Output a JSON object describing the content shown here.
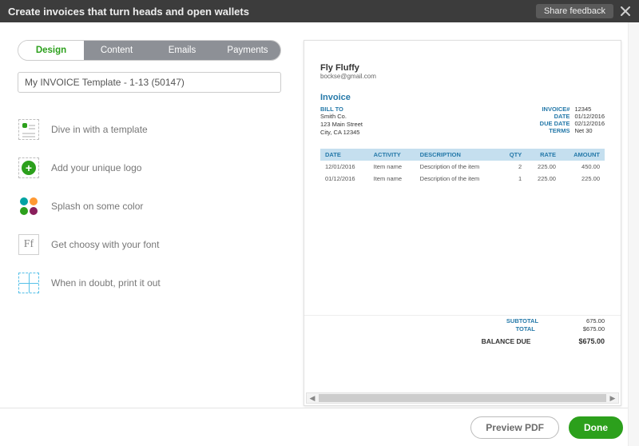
{
  "header": {
    "title": "Create invoices that turn heads and open wallets",
    "feedback_label": "Share feedback"
  },
  "tabs": [
    {
      "label": "Design",
      "active": true
    },
    {
      "label": "Content",
      "active": false
    },
    {
      "label": "Emails",
      "active": false
    },
    {
      "label": "Payments",
      "active": false
    }
  ],
  "template_name_value": "My INVOICE Template - 1-13 (50147)",
  "options": {
    "template_label": "Dive in with a template",
    "logo_label": "Add your unique logo",
    "color_label": "Splash on some color",
    "font_label": "Get choosy with your font",
    "print_label": "When in doubt, print it out",
    "font_sample": "Ff"
  },
  "invoice": {
    "company_name": "Fly Fluffy",
    "company_email": "bockse@gmail.com",
    "doc_title": "Invoice",
    "bill_to_label": "BILL TO",
    "bill_to_name": "Smith Co.",
    "bill_to_street": "123 Main Street",
    "bill_to_city": "City, CA 12345",
    "meta": {
      "invoice_label": "INVOICE#",
      "invoice_value": "12345",
      "date_label": "DATE",
      "date_value": "01/12/2016",
      "due_label": "DUE DATE",
      "due_value": "02/12/2016",
      "terms_label": "TERMS",
      "terms_value": "Net 30"
    },
    "columns": {
      "date": "DATE",
      "activity": "ACTIVITY",
      "description": "DESCRIPTION",
      "qty": "QTY",
      "rate": "RATE",
      "amount": "AMOUNT"
    },
    "lines": [
      {
        "date": "12/01/2016",
        "activity": "Item name",
        "description": "Description of the item",
        "qty": "2",
        "rate": "225.00",
        "amount": "450.00"
      },
      {
        "date": "01/12/2016",
        "activity": "Item name",
        "description": "Description of the item",
        "qty": "1",
        "rate": "225.00",
        "amount": "225.00"
      }
    ],
    "totals": {
      "subtotal_label": "SUBTOTAL",
      "subtotal_value": "675.00",
      "total_label": "TOTAL",
      "total_value": "$675.00",
      "balance_label": "BALANCE DUE",
      "balance_value": "$675.00"
    }
  },
  "footer": {
    "preview_label": "Preview PDF",
    "done_label": "Done"
  }
}
